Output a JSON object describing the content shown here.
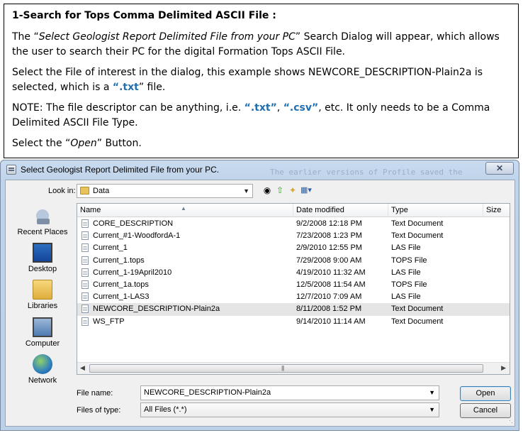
{
  "instructions": {
    "heading_main": "1-Search for Tops Comma Delimited ASCII File",
    "heading_suffix": " :",
    "p1_pre": "The “",
    "p1_em": "Select Geologist Report Delimited File from your PC",
    "p1_post": "” Search Dialog will appear, which allows the user to search their PC for the digital Formation Tops ASCII File.",
    "p2_pre": "Select the File of interest in the dialog, this example shows NEWCORE_DESCRIPTION-Plain2a  is selected, which is a ",
    "p2_hl": "“.txt",
    "p2_post": "” file.",
    "p3_pre": "NOTE: The file descriptor can be anything, i.e. ",
    "p3_hl1": "“.txt”",
    "p3_mid": ", ",
    "p3_hl2": "“.csv”",
    "p3_post": ", etc.  It only needs to be a Comma Delimited ASCII File Type.",
    "p4_pre": "Select the “",
    "p4_em": "Open",
    "p4_post": "” Button."
  },
  "dialog": {
    "title": "Select Geologist Report Delimited File from your PC.",
    "background_text": "The earlier versions of Profile saved the",
    "close_label": "✕",
    "look_in_label": "Look in:",
    "look_in_value": "Data",
    "places": [
      "Recent Places",
      "Desktop",
      "Libraries",
      "Computer",
      "Network"
    ],
    "columns": {
      "name": "Name",
      "date": "Date modified",
      "type": "Type",
      "size": "Size"
    },
    "files": [
      {
        "name": "CORE_DESCRIPTION",
        "date": "9/2/2008 12:18 PM",
        "type": "Text Document"
      },
      {
        "name": "Current_#1-WoodfordA-1",
        "date": "7/23/2008 1:23 PM",
        "type": "Text Document"
      },
      {
        "name": "Current_1",
        "date": "2/9/2010 12:55 PM",
        "type": "LAS File"
      },
      {
        "name": "Current_1.tops",
        "date": "7/29/2008 9:00 AM",
        "type": "TOPS File"
      },
      {
        "name": "Current_1-19April2010",
        "date": "4/19/2010 11:32 AM",
        "type": "LAS File"
      },
      {
        "name": "Current_1a.tops",
        "date": "12/5/2008 11:54 AM",
        "type": "TOPS File"
      },
      {
        "name": "Current_1-LAS3",
        "date": "12/7/2010 7:09 AM",
        "type": "LAS File"
      },
      {
        "name": "NEWCORE_DESCRIPTION-Plain2a",
        "date": "8/11/2008 1:52 PM",
        "type": "Text Document"
      },
      {
        "name": "WS_FTP",
        "date": "9/14/2010 11:14 AM",
        "type": "Text Document"
      }
    ],
    "selected_index": 7,
    "file_name_label": "File name:",
    "file_name_value": "NEWCORE_DESCRIPTION-Plain2a",
    "files_of_type_label": "Files of type:",
    "files_of_type_value": "All Files (*.*)",
    "open_label": "Open",
    "cancel_label": "Cancel"
  },
  "colors": {
    "highlight": "#1f6fb2",
    "selected_row": "#e5e5e5",
    "title_bar": "#c9dbef"
  }
}
